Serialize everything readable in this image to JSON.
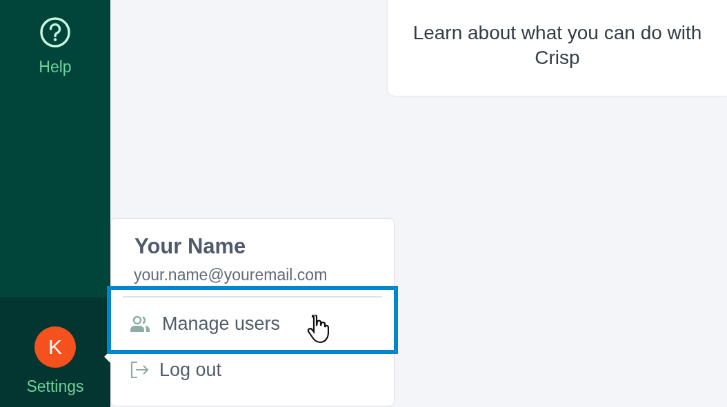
{
  "sidebar": {
    "items": [
      {
        "kind": "help",
        "label": "Help"
      },
      {
        "kind": "settings",
        "label": "Settings",
        "avatar": "K",
        "selected": true
      }
    ]
  },
  "card": {
    "text": "Learn about what you can do with Crisp"
  },
  "account_menu": {
    "name": "Your Name",
    "email": "your.name@youremail.com",
    "items": [
      {
        "kind": "users",
        "label": "Manage users",
        "highlighted": true
      },
      {
        "kind": "logout",
        "label": "Log out",
        "highlighted": false
      }
    ]
  }
}
